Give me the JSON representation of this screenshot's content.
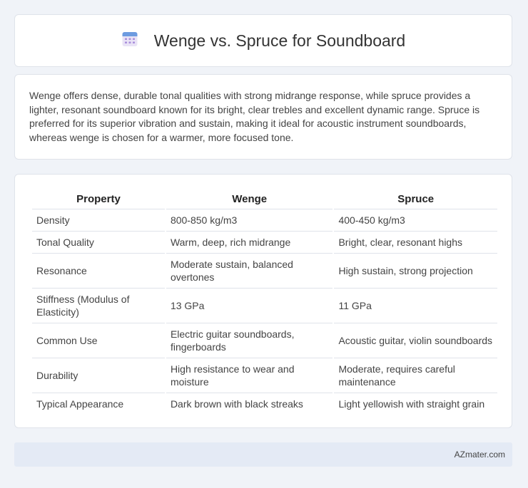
{
  "header": {
    "icon": "calendar-icon",
    "title": "Wenge vs. Spruce for Soundboard"
  },
  "summary": "Wenge offers dense, durable tonal qualities with strong midrange response, while spruce provides a lighter, resonant soundboard known for its bright, clear trebles and excellent dynamic range. Spruce is preferred for its superior vibration and sustain, making it ideal for acoustic instrument soundboards, whereas wenge is chosen for a warmer, more focused tone.",
  "table": {
    "headers": [
      "Property",
      "Wenge",
      "Spruce"
    ],
    "rows": [
      [
        "Density",
        "800-850 kg/m3",
        "400-450 kg/m3"
      ],
      [
        "Tonal Quality",
        "Warm, deep, rich midrange",
        "Bright, clear, resonant highs"
      ],
      [
        "Resonance",
        "Moderate sustain, balanced overtones",
        "High sustain, strong projection"
      ],
      [
        "Stiffness (Modulus of Elasticity)",
        "13 GPa",
        "11 GPa"
      ],
      [
        "Common Use",
        "Electric guitar soundboards, fingerboards",
        "Acoustic guitar, violin soundboards"
      ],
      [
        "Durability",
        "High resistance to wear and moisture",
        "Moderate, requires careful maintenance"
      ],
      [
        "Typical Appearance",
        "Dark brown with black streaks",
        "Light yellowish with straight grain"
      ]
    ]
  },
  "footer": {
    "brand": "AZmater.com"
  },
  "colors": {
    "background": "#f0f3f8",
    "card": "#ffffff",
    "footer": "#e4eaf5",
    "border": "#dfe3ea"
  }
}
